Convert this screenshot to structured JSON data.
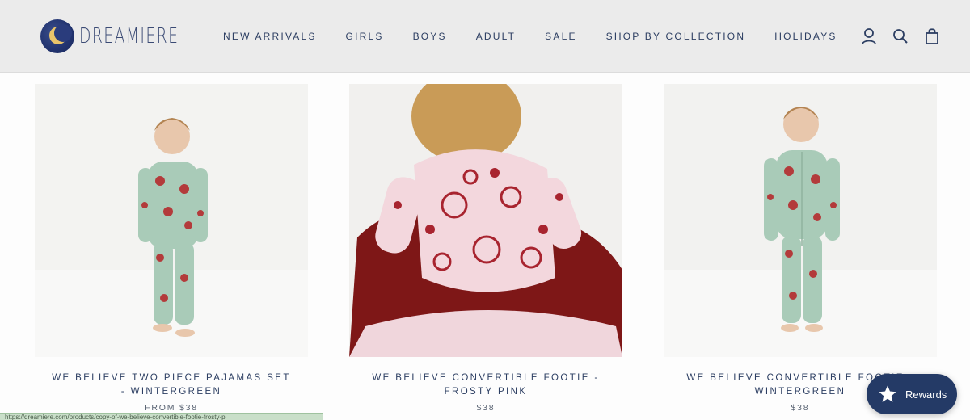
{
  "brand": {
    "name": "DREAMIERE"
  },
  "nav": [
    {
      "label": "NEW ARRIVALS"
    },
    {
      "label": "GIRLS"
    },
    {
      "label": "BOYS"
    },
    {
      "label": "ADULT"
    },
    {
      "label": "SALE"
    },
    {
      "label": "SHOP BY COLLECTION"
    },
    {
      "label": "HOLIDAYS"
    }
  ],
  "header_icons": [
    "account-icon",
    "search-icon",
    "cart-icon"
  ],
  "products": [
    {
      "title": "WE BELIEVE TWO PIECE PAJAMAS SET - WINTERGREEN",
      "price": "FROM $38",
      "image": "toddler boy in wintergreen santa print two piece pajamas"
    },
    {
      "title": "WE BELIEVE CONVERTIBLE FOOTIE - FROSTY PINK",
      "price": "$38",
      "image": "child from behind in pink santa print footie sitting on red blanket"
    },
    {
      "title": "WE BELIEVE CONVERTIBLE FOOTIE - WINTERGREEN",
      "price": "$38",
      "image": "toddler boy in wintergreen santa print footie"
    }
  ],
  "rewards": {
    "label": "Rewards",
    "icon": "star-icon"
  },
  "status_url": "https://dreamiere.com/products/copy-of-we-believe-convertible-footie-frosty-pi",
  "colors": {
    "brand_navy": "#243a66",
    "header_bg": "#ebebeb",
    "nav_text": "#2c3e62"
  }
}
